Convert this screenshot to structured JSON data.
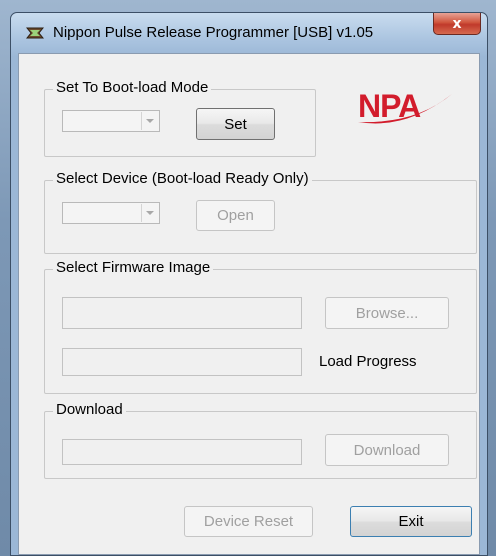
{
  "window": {
    "title": "Nippon Pulse Release Programmer [USB] v1.05",
    "close_glyph": "x"
  },
  "logo": {
    "text": "NPA",
    "color": "#d21c2c"
  },
  "bootload": {
    "legend": "Set To Boot-load Mode",
    "combo_value": "",
    "set_label": "Set"
  },
  "device": {
    "legend": "Select Device (Boot-load Ready Only)",
    "combo_value": "",
    "open_label": "Open"
  },
  "firmware": {
    "legend": "Select Firmware Image",
    "path_value": "",
    "browse_label": "Browse...",
    "progress_value": "",
    "progress_label": "Load Progress"
  },
  "download": {
    "legend": "Download",
    "progress_value": "",
    "download_label": "Download"
  },
  "footer": {
    "reset_label": "Device Reset",
    "exit_label": "Exit"
  },
  "icons": {
    "app": "programmer-app-icon",
    "close": "close-icon",
    "dropdown": "chevron-down-icon"
  }
}
